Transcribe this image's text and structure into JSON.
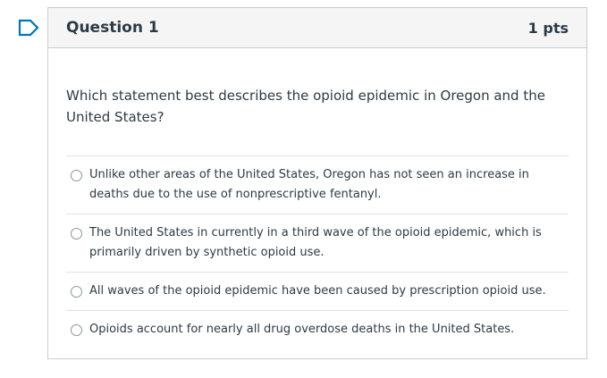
{
  "question": {
    "title": "Question 1",
    "points": "1 pts",
    "text": "Which statement best describes the opioid epidemic in Oregon and the United States?"
  },
  "answers": [
    {
      "label": "Unlike other areas of the United States, Oregon has not seen an increase in deaths due to the use of nonprescriptive fentanyl."
    },
    {
      "label": "The United States in currently in a third wave of the opioid epidemic, which is primarily driven by synthetic opioid use."
    },
    {
      "label": "All waves of the opioid epidemic have been caused by prescription opioid use."
    },
    {
      "label": "Opioids account for nearly all drug overdose deaths in the United States."
    }
  ],
  "icons": {
    "flag": "flag-question-icon"
  },
  "colors": {
    "accent": "#0374b5",
    "text": "#2d3b45",
    "border": "#c7cdd1",
    "header_bg": "#f5f5f5"
  }
}
